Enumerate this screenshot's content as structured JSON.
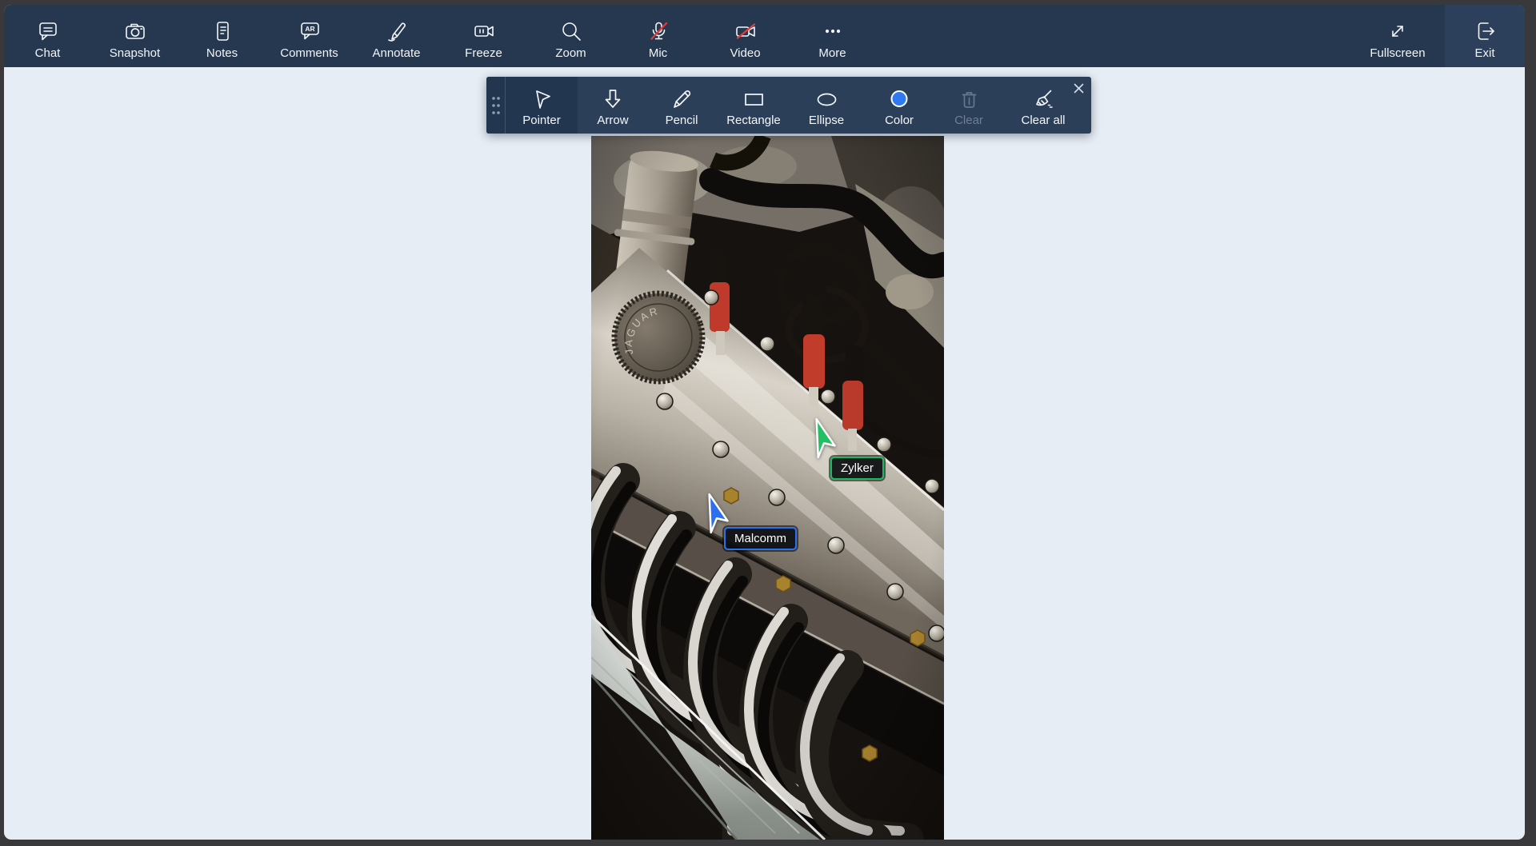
{
  "topbar": {
    "items": [
      {
        "label": "Chat",
        "icon": "chat-icon"
      },
      {
        "label": "Snapshot",
        "icon": "snapshot-icon"
      },
      {
        "label": "Notes",
        "icon": "notes-icon"
      },
      {
        "label": "Comments",
        "icon": "comments-icon",
        "badge_text": "AR"
      },
      {
        "label": "Annotate",
        "icon": "annotate-icon"
      },
      {
        "label": "Freeze",
        "icon": "freeze-icon"
      },
      {
        "label": "Zoom",
        "icon": "zoom-icon"
      },
      {
        "label": "Mic",
        "icon": "mic-icon",
        "muted": true
      },
      {
        "label": "Video",
        "icon": "video-icon",
        "muted": true
      },
      {
        "label": "More",
        "icon": "more-icon"
      }
    ],
    "right_items": [
      {
        "label": "Fullscreen",
        "icon": "fullscreen-icon"
      },
      {
        "label": "Exit",
        "icon": "exit-icon"
      }
    ]
  },
  "annotation_toolbar": {
    "tools": [
      {
        "label": "Pointer",
        "icon": "pointer-icon",
        "selected": true
      },
      {
        "label": "Arrow",
        "icon": "arrow-down-icon"
      },
      {
        "label": "Pencil",
        "icon": "pencil-icon"
      },
      {
        "label": "Rectangle",
        "icon": "rectangle-icon"
      },
      {
        "label": "Ellipse",
        "icon": "ellipse-icon"
      },
      {
        "label": "Color",
        "icon": "color-swatch-icon",
        "swatch_color": "#2f7af2"
      },
      {
        "label": "Clear",
        "icon": "trash-icon",
        "disabled": true
      },
      {
        "label": "Clear all",
        "icon": "broom-icon"
      }
    ]
  },
  "annotations": {
    "pointers": [
      {
        "label": "Zylker",
        "color": "#22c063"
      },
      {
        "label": "Malcomm",
        "color": "#2c6ff0"
      }
    ]
  },
  "photo": {
    "engraving": "JAGUAR"
  },
  "colors": {
    "topbar_background": "#263850",
    "exit_background": "#2c3f5b",
    "toolbar_background": "#2c3f58",
    "toolbar_selected": "#223650",
    "workspace_background": "#e7edf5",
    "mute_slash": "#e23b3b",
    "pointer_green": "#22c063",
    "pointer_blue": "#2c6ff0"
  }
}
